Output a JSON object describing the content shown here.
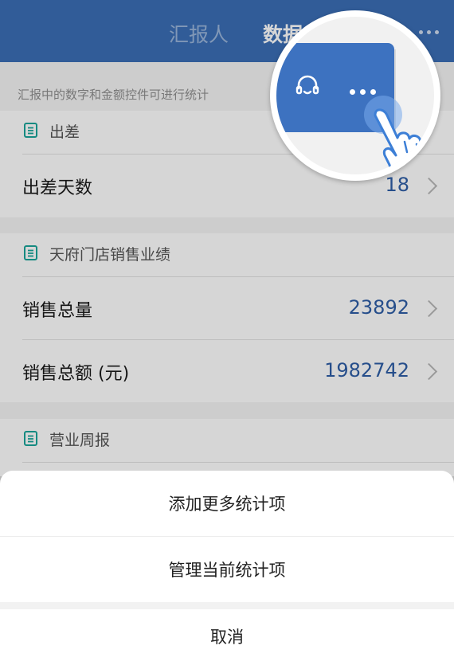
{
  "header": {
    "tabs": [
      {
        "label": "汇报人"
      },
      {
        "label": "数据"
      }
    ]
  },
  "hint": "汇报中的数字和金额控件可进行统计",
  "sections": [
    {
      "title": "出差",
      "rows": [
        {
          "label": "出差天数",
          "value": "18"
        }
      ]
    },
    {
      "title": "天府门店销售业绩",
      "rows": [
        {
          "label": "销售总量",
          "value": "23892"
        },
        {
          "label": "销售总额 (元)",
          "value": "1982742"
        }
      ]
    },
    {
      "title": "营业周报",
      "rows": []
    }
  ],
  "action_sheet": {
    "options": [
      {
        "label": "添加更多统计项"
      },
      {
        "label": "管理当前统计项"
      }
    ],
    "cancel_label": "取消"
  },
  "colors": {
    "primary": "#3b6eb6",
    "value_text": "#2e5ea6",
    "section_icon": "#1aa59a"
  },
  "icons": {
    "top_menu": "more-icon",
    "bubble_left": "headset-icon",
    "bubble_right": "more-icon",
    "gesture": "tap-hand-icon",
    "section": "document-icon",
    "row_arrow": "chevron-right-icon"
  }
}
